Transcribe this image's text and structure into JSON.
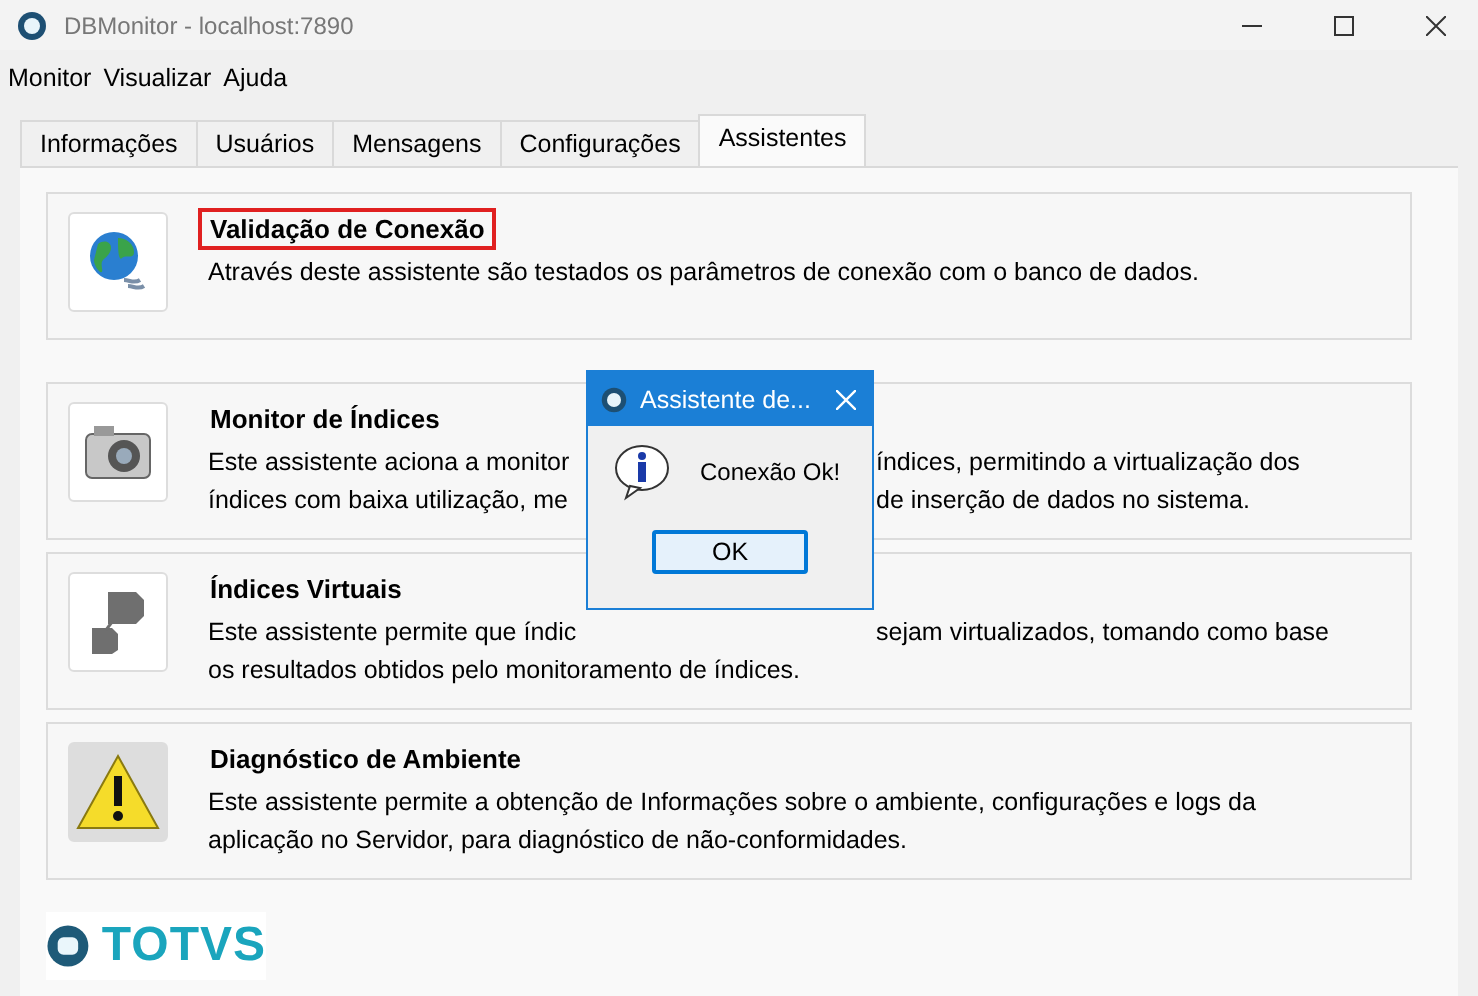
{
  "window": {
    "title": "DBMonitor - localhost:7890"
  },
  "menu": [
    "Monitor",
    "Visualizar",
    "Ajuda"
  ],
  "tabs": [
    {
      "label": "Informações",
      "selected": false
    },
    {
      "label": "Usuários",
      "selected": false
    },
    {
      "label": "Mensagens",
      "selected": false
    },
    {
      "label": "Configurações",
      "selected": false
    },
    {
      "label": "Assistentes",
      "selected": true
    }
  ],
  "assistants": [
    {
      "kind": "globe",
      "title": "Validação de Conexão",
      "highlighted": true,
      "lines": [
        [
          "Através deste assistente são testados os parâmetros de conexão com o banco de dados."
        ]
      ]
    },
    {
      "kind": "camera",
      "title": "Monitor de Índices",
      "highlighted": false,
      "lines": [
        [
          "Este assistente aciona a monitor",
          "índices, permitindo a virtualização dos"
        ],
        [
          "índices com baixa utilização, me",
          "de inserção de dados no sistema."
        ]
      ]
    },
    {
      "kind": "shapes",
      "title": "Índices Virtuais",
      "highlighted": false,
      "lines": [
        [
          "Este assistente permite que índic",
          "sejam virtualizados, tomando como base"
        ],
        [
          "os resultados obtidos pelo monitoramento de índices."
        ]
      ]
    },
    {
      "kind": "warning",
      "title": "Diagnóstico de Ambiente",
      "highlighted": false,
      "lines": [
        [
          "Este assistente permite a obtenção de Informações sobre o ambiente, configurações e logs da"
        ],
        [
          "aplicação no Servidor, para diagnóstico de não-conformidades."
        ]
      ]
    }
  ],
  "logo": {
    "text": "TOTVS"
  },
  "dialog": {
    "title": "Assistente de...",
    "message": "Conexão Ok!",
    "button": "OK"
  }
}
